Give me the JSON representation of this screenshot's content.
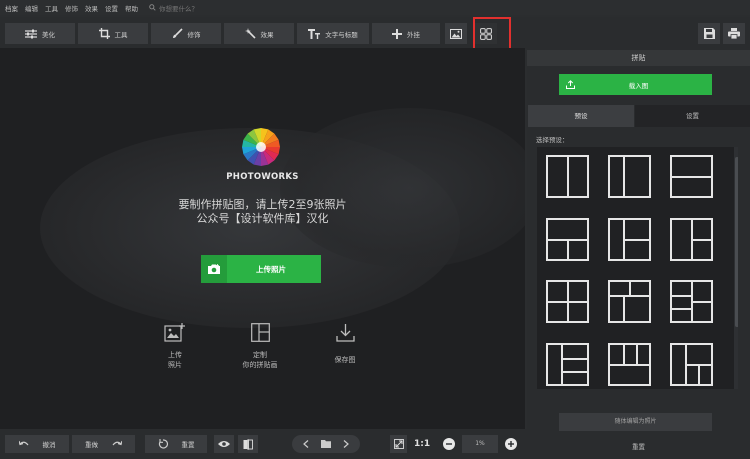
{
  "menu": {
    "items": [
      "档案",
      "编辑",
      "工具",
      "修饰",
      "效果",
      "设置",
      "帮助"
    ],
    "search_placeholder": "你想要什么？"
  },
  "toolbar": {
    "tabs": [
      {
        "label": "美化",
        "icon": "sliders-icon"
      },
      {
        "label": "工具",
        "icon": "crop-icon"
      },
      {
        "label": "修饰",
        "icon": "brush-icon"
      },
      {
        "label": "效果",
        "icon": "magic-wand-icon"
      },
      {
        "label": "文字与标题",
        "icon": "text-icon"
      },
      {
        "label": "外挂",
        "icon": "plus-icon"
      }
    ],
    "image_icon": "image-icon",
    "collage_icon": "collage-grid-icon",
    "save_icon": "save-icon",
    "print_icon": "print-icon",
    "highlight_color": "#e2302e"
  },
  "canvas": {
    "logo_word": "PHOTOWORKS",
    "instruction_line1": "要制作拼贴图，请上传2至9张照片",
    "instruction_line2": "公众号【设计软件库】汉化",
    "upload_button": "上传照片",
    "steps": [
      {
        "icon": "add-photo-icon",
        "line1": "上传",
        "line2": "照片"
      },
      {
        "icon": "layout-icon",
        "line1": "定制",
        "line2": "你的拼贴画"
      },
      {
        "icon": "download-icon",
        "line1": "保存图",
        "line2": ""
      }
    ]
  },
  "panel": {
    "title": "拼贴",
    "load_button": "载入图",
    "tabs": [
      "预设",
      "设置"
    ],
    "active_tab": "预设",
    "preset_label": "选择预设：",
    "photo_button": "随体编辑为照片",
    "reset_link": "重置"
  },
  "bottom": {
    "undo": "撤消",
    "redo": "重做",
    "reset": "重置",
    "zoom_ratio": "1:1",
    "zoom_value": "1%"
  },
  "colors": {
    "accent_green": "#2bb345",
    "bg_dark": "#1f2022",
    "panel": "#2a2c2e"
  }
}
